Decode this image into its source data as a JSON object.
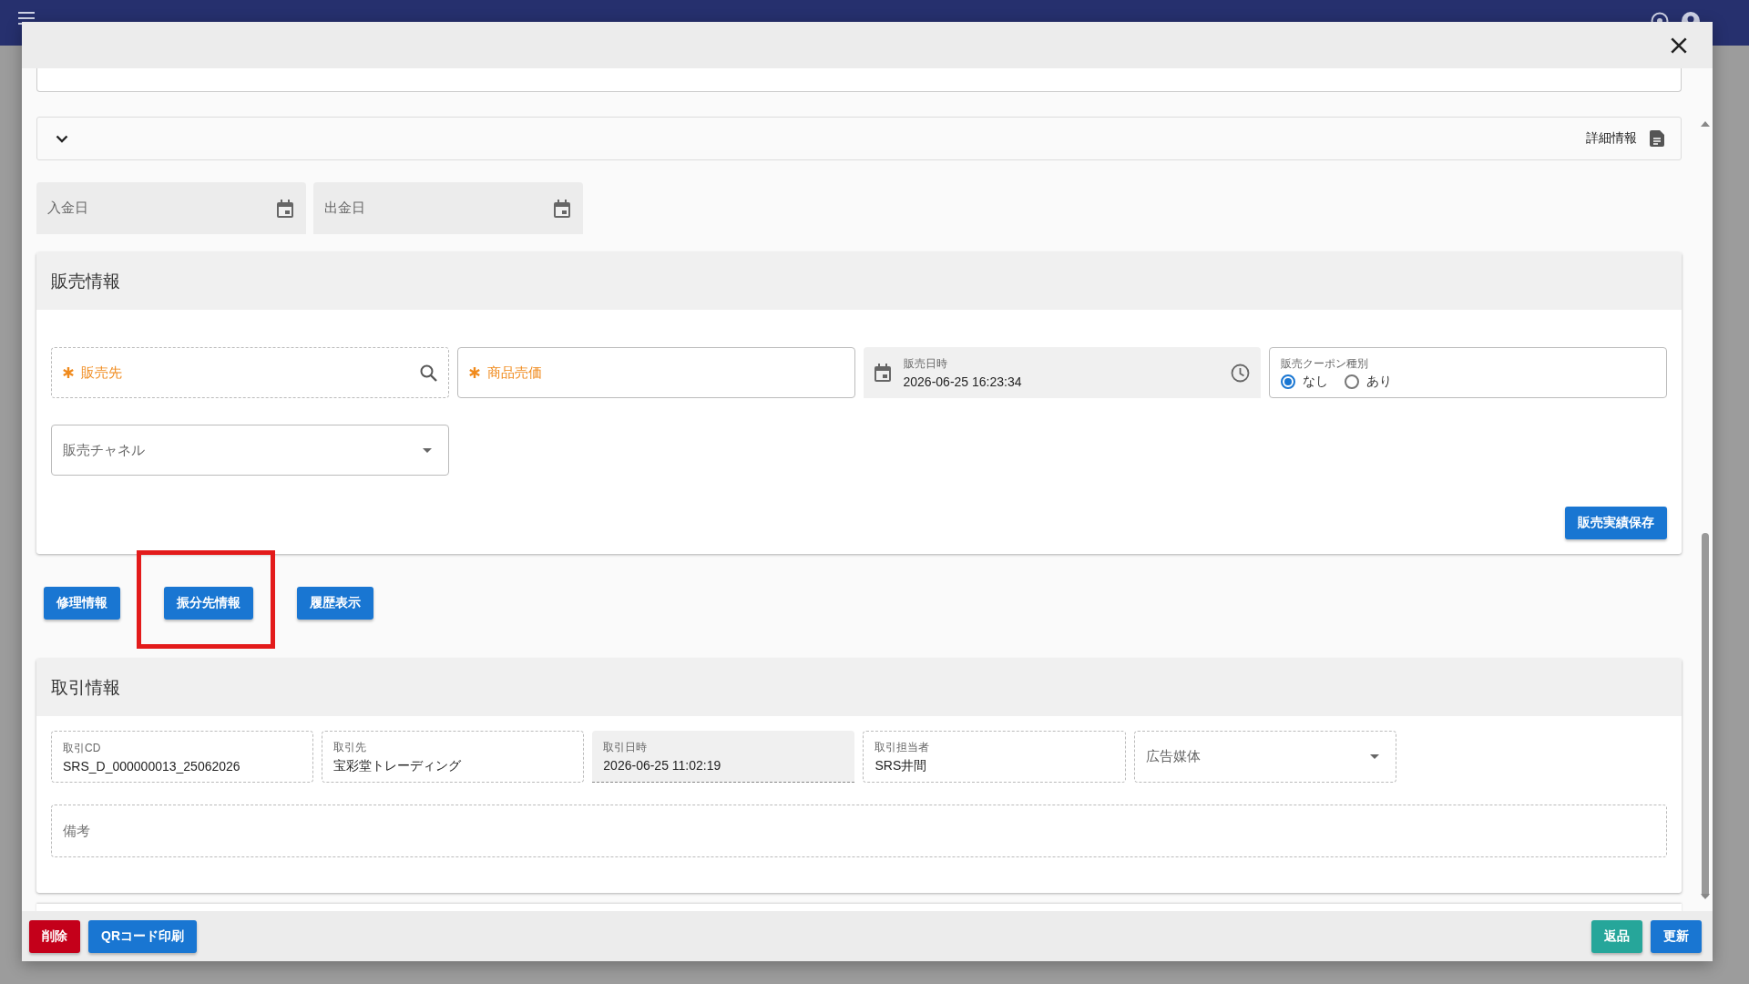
{
  "dialog": {
    "detail_bar": {
      "label": "詳細情報"
    },
    "date_fields": [
      {
        "label": "入金日"
      },
      {
        "label": "出金日"
      }
    ],
    "sales": {
      "title": "販売情報",
      "fields": [
        {
          "kind": "search",
          "label": "販売先",
          "required": true,
          "readonly": true
        },
        {
          "kind": "text",
          "label": "商品売価",
          "required": true,
          "readonly": false
        },
        {
          "kind": "datetime",
          "label": "販売日時",
          "value": "2026-06-25 16:23:34"
        },
        {
          "kind": "radio",
          "label": "販売クーポン種別",
          "options": [
            {
              "label": "なし",
              "selected": true
            },
            {
              "label": "あり",
              "selected": false
            }
          ]
        },
        {
          "kind": "select",
          "label": "販売チャネル",
          "readonly": false
        }
      ],
      "save_button": "販売実績保存"
    },
    "actions": [
      {
        "label": "修理情報",
        "highlighted": false
      },
      {
        "label": "振分先情報",
        "highlighted": true
      },
      {
        "label": "履歴表示",
        "highlighted": false
      }
    ],
    "transaction": {
      "title": "取引情報",
      "fields": [
        {
          "kind": "text",
          "label": "取引CD",
          "value": "SRS_D_000000013_25062026",
          "readonly": true
        },
        {
          "kind": "text",
          "label": "取引先",
          "value": "宝彩堂トレーディング",
          "readonly": true
        },
        {
          "kind": "filled",
          "label": "取引日時",
          "value": "2026-06-25 11:02:19"
        },
        {
          "kind": "text",
          "label": "取引担当者",
          "value": "SRS井間",
          "readonly": true
        },
        {
          "kind": "select",
          "label": "広告媒体",
          "readonly": true
        }
      ],
      "remarks": {
        "placeholder": "備考"
      }
    },
    "footer": {
      "left": [
        {
          "label": "削除",
          "kind": "danger"
        },
        {
          "label": "QRコード印刷",
          "kind": "primary"
        }
      ],
      "right": [
        {
          "label": "返品",
          "kind": "teal"
        },
        {
          "label": "更新",
          "kind": "primary"
        }
      ]
    }
  }
}
